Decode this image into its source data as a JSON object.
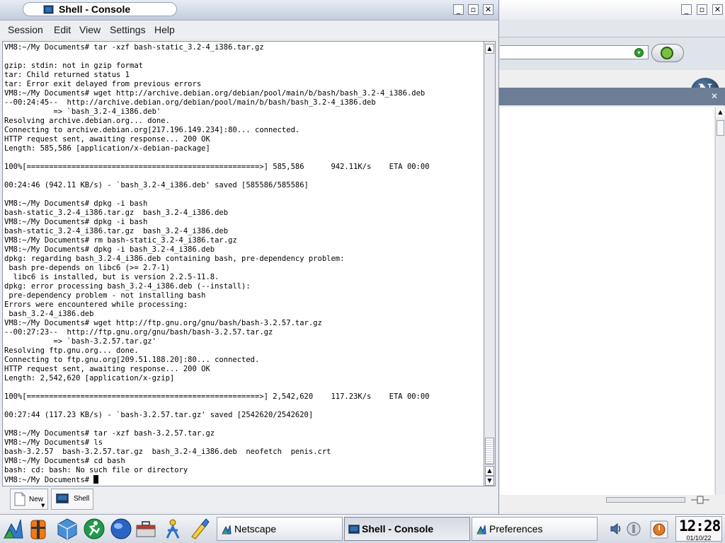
{
  "console_window": {
    "title": "Shell - Console",
    "menu": [
      "Session",
      "Edit",
      "View",
      "Settings",
      "Help"
    ],
    "terminal_lines": [
      "VM8:~/My Documents# tar -xzf bash-static_3.2-4_i386.tar.gz",
      "",
      "gzip: stdin: not in gzip format",
      "tar: Child returned status 1",
      "tar: Error exit delayed from previous errors",
      "VM8:~/My Documents# wget http://archive.debian.org/debian/pool/main/b/bash/bash_3.2-4_i386.deb",
      "--00:24:45--  http://archive.debian.org/debian/pool/main/b/bash/bash_3.2-4_i386.deb",
      "           => `bash_3.2-4_i386.deb'",
      "Resolving archive.debian.org... done.",
      "Connecting to archive.debian.org[217.196.149.234]:80... connected.",
      "HTTP request sent, awaiting response... 200 OK",
      "Length: 585,586 [application/x-debian-package]",
      "",
      "100%[====================================================>] 585,586      942.11K/s    ETA 00:00",
      "",
      "00:24:46 (942.11 KB/s) - `bash_3.2-4_i386.deb' saved [585586/585586]",
      "",
      "VM8:~/My Documents# dpkg -i bash",
      "bash-static_3.2-4_i386.tar.gz  bash_3.2-4_i386.deb",
      "VM8:~/My Documents# dpkg -i bash",
      "bash-static_3.2-4_i386.tar.gz  bash_3.2-4_i386.deb",
      "VM8:~/My Documents# rm bash-static_3.2-4_i386.tar.gz",
      "VM8:~/My Documents# dpkg -i bash_3.2-4_i386.deb",
      "dpkg: regarding bash_3.2-4_i386.deb containing bash, pre-dependency problem:",
      " bash pre-depends on libc6 (>= 2.7-1)",
      "  libc6 is installed, but is version 2.2.5-11.8.",
      "dpkg: error processing bash_3.2-4_i386.deb (--install):",
      " pre-dependency problem - not installing bash",
      "Errors were encountered while processing:",
      " bash_3.2-4_i386.deb",
      "VM8:~/My Documents# wget http://ftp.gnu.org/gnu/bash/bash-3.2.57.tar.gz",
      "--00:27:23--  http://ftp.gnu.org/gnu/bash/bash-3.2.57.tar.gz",
      "           => `bash-3.2.57.tar.gz'",
      "Resolving ftp.gnu.org... done.",
      "Connecting to ftp.gnu.org[209.51.188.20]:80... connected.",
      "HTTP request sent, awaiting response... 200 OK",
      "Length: 2,542,620 [application/x-gzip]",
      "",
      "100%[====================================================>] 2,542,620    117.23K/s    ETA 00:00",
      "",
      "00:27:44 (117.23 KB/s) - `bash-3.2.57.tar.gz' saved [2542620/2542620]",
      "",
      "VM8:~/My Documents# tar -xzf bash-3.2.57.tar.gz",
      "VM8:~/My Documents# ls",
      "bash-3.2.57  bash-3.2.57.tar.gz  bash_3.2-4_i386.deb  neofetch  penis.crt",
      "VM8:~/My Documents# cd bash",
      "bash: cd: bash: No such file or directory",
      "VM8:~/My Documents# "
    ],
    "session_tabs": [
      {
        "label": "New",
        "icon": "new-session-icon"
      },
      {
        "label": "Shell",
        "icon": "terminal-icon"
      }
    ]
  },
  "background_window": {
    "logo_letter": "N",
    "close_glyph": "✕"
  },
  "taskbar": {
    "launchers": [
      "kde-menu-icon",
      "lifejacket-icon",
      "cube-icon",
      "runner-icon",
      "globe-icon",
      "toolbox-icon",
      "figure-icon",
      "brush-icon"
    ],
    "tasks": [
      {
        "label": "Netscape",
        "icon": "netscape-icon",
        "active": false
      },
      {
        "label": "Shell - Console",
        "icon": "terminal-icon",
        "active": true
      },
      {
        "label": "Preferences",
        "icon": "preferences-icon",
        "active": false
      }
    ],
    "clock_time": "12:28",
    "clock_date": "01/10/22"
  },
  "colors": {
    "terminal_bg": "#ffffff",
    "terminal_fg": "#000000",
    "titlebar": "#c3ccdd",
    "panel_header": "#6c7d96"
  }
}
